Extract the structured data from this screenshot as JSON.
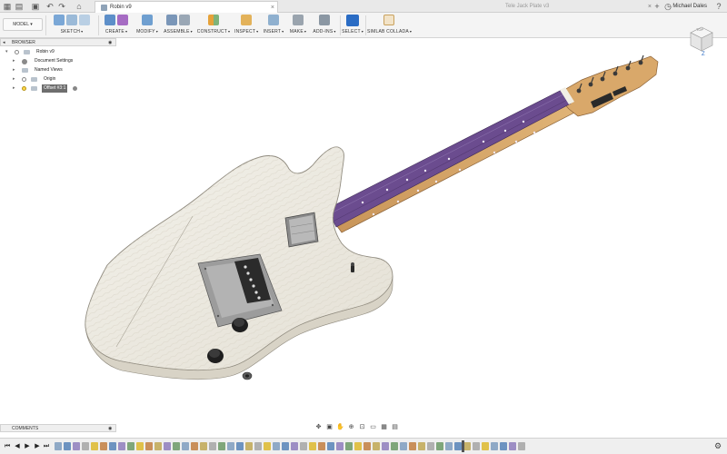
{
  "tabs": [
    {
      "label": "Robin v9",
      "active": true
    },
    {
      "label": "Tele Jack Plate v3",
      "active": false
    }
  ],
  "user": {
    "name": "Michael Dales"
  },
  "toolbar": {
    "mode": "MODEL",
    "groups": [
      {
        "label": "SKETCH"
      },
      {
        "label": "CREATE"
      },
      {
        "label": "MODIFY"
      },
      {
        "label": "ASSEMBLE"
      },
      {
        "label": "CONSTRUCT"
      },
      {
        "label": "INSPECT"
      },
      {
        "label": "INSERT"
      },
      {
        "label": "MAKE"
      },
      {
        "label": "ADD-INS"
      },
      {
        "label": "SELECT"
      },
      {
        "label": "SIMLAB COLLADA"
      }
    ],
    "caret": "▾"
  },
  "browser": {
    "title": "BROWSER",
    "items": [
      {
        "label": "Robin v9",
        "level": 0
      },
      {
        "label": "Document Settings",
        "level": 1
      },
      {
        "label": "Named Views",
        "level": 1
      },
      {
        "label": "Origin",
        "level": 1
      },
      {
        "label": "Offset #3:1",
        "level": 1,
        "highlight": true
      }
    ]
  },
  "comments": {
    "title": "COMMENTS"
  },
  "viewcube": {
    "face": "TOP",
    "axis": "Z"
  },
  "colors": {
    "accent": "#2a6cc4",
    "body": "#ece9e0",
    "fretboard": "#6b4c8f",
    "neck": "#d6a86a"
  },
  "icons": {
    "app_grid": "grid-icon",
    "file": "file-icon",
    "save": "save-icon",
    "undo": "undo-icon",
    "redo": "redo-icon",
    "close_tab": "close-icon",
    "add_tab": "plus-icon",
    "help": "help-icon"
  }
}
